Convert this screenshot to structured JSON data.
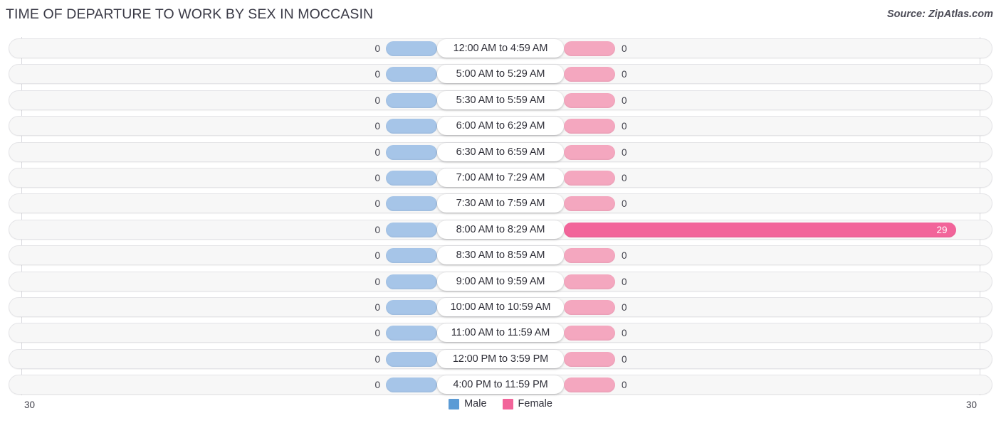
{
  "header": {
    "title": "TIME OF DEPARTURE TO WORK BY SEX IN MOCCASIN",
    "source": "Source: ZipAtlas.com"
  },
  "axis": {
    "left_max": "30",
    "right_max": "30"
  },
  "legend": {
    "items": [
      {
        "label": "Male",
        "color": "#5b9bd5"
      },
      {
        "label": "Female",
        "color": "#f2649a"
      }
    ]
  },
  "colors": {
    "male_light": "#a6c5e8",
    "male_strong": "#5b9bd5",
    "female_light": "#f4a7bf",
    "female_strong": "#f2649a",
    "track": "#f7f7f7",
    "text": "#43434d"
  },
  "chart_data": {
    "type": "bar",
    "orientation": "horizontal",
    "style": "diverging-bidirectional",
    "title": "TIME OF DEPARTURE TO WORK BY SEX IN MOCCASIN",
    "xlabel": "",
    "ylabel": "",
    "xlim_left": [
      30,
      0
    ],
    "xlim_right": [
      0,
      30
    ],
    "grid": true,
    "legend_position": "bottom-center",
    "categories": [
      "12:00 AM to 4:59 AM",
      "5:00 AM to 5:29 AM",
      "5:30 AM to 5:59 AM",
      "6:00 AM to 6:29 AM",
      "6:30 AM to 6:59 AM",
      "7:00 AM to 7:29 AM",
      "7:30 AM to 7:59 AM",
      "8:00 AM to 8:29 AM",
      "8:30 AM to 8:59 AM",
      "9:00 AM to 9:59 AM",
      "10:00 AM to 10:59 AM",
      "11:00 AM to 11:59 AM",
      "12:00 PM to 3:59 PM",
      "4:00 PM to 11:59 PM"
    ],
    "series": [
      {
        "name": "Male",
        "values": [
          0,
          0,
          0,
          0,
          0,
          0,
          0,
          0,
          0,
          0,
          0,
          0,
          0,
          0
        ],
        "labels": [
          "0",
          "0",
          "0",
          "0",
          "0",
          "0",
          "0",
          "0",
          "0",
          "0",
          "0",
          "0",
          "0",
          "0"
        ]
      },
      {
        "name": "Female",
        "values": [
          0,
          0,
          0,
          0,
          0,
          0,
          0,
          29,
          0,
          0,
          0,
          0,
          0,
          0
        ],
        "labels": [
          "0",
          "0",
          "0",
          "0",
          "0",
          "0",
          "0",
          "29",
          "0",
          "0",
          "0",
          "0",
          "0",
          "0"
        ]
      }
    ]
  }
}
